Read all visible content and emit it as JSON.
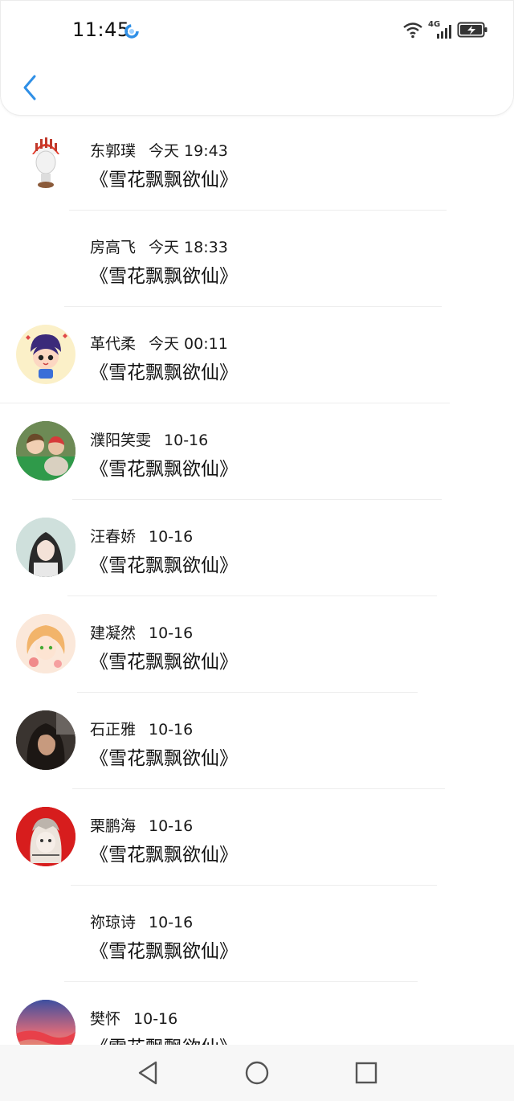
{
  "status_bar": {
    "time": "11:45",
    "network_label": "4G",
    "icons": [
      "activity-ring-icon",
      "wifi-icon",
      "signal-icon",
      "battery-charging-icon"
    ]
  },
  "header": {
    "back_icon": "chevron-left-icon"
  },
  "messages": [
    {
      "name": "东郭璞",
      "time": "今天 19:43",
      "title": "《雪花飘飘欲仙》",
      "avatar": "chief-statue"
    },
    {
      "name": "房高飞",
      "time": "今天 18:33",
      "title": "《雪花飘飘欲仙》",
      "avatar": "none"
    },
    {
      "name": "革代柔",
      "time": "今天 00:11",
      "title": "《雪花飘飘欲仙》",
      "avatar": "cartoon-boy"
    },
    {
      "name": "濮阳笑雯",
      "time": "10-16",
      "title": "《雪花飘飘欲仙》",
      "avatar": "couple-photo"
    },
    {
      "name": "汪春娇",
      "time": "10-16",
      "title": "《雪花飘飘欲仙》",
      "avatar": "girl-portrait"
    },
    {
      "name": "建凝然",
      "time": "10-16",
      "title": "《雪花飘飘欲仙》",
      "avatar": "anime-girl"
    },
    {
      "name": "石正雅",
      "time": "10-16",
      "title": "《雪花飘飘欲仙》",
      "avatar": "dark-portrait"
    },
    {
      "name": "栗鹏海",
      "time": "10-16",
      "title": "《雪花飘飘欲仙》",
      "avatar": "red-anime"
    },
    {
      "name": "祢琼诗",
      "time": "10-16",
      "title": "《雪花飘飘欲仙》",
      "avatar": "none"
    },
    {
      "name": "樊怀",
      "time": "10-16",
      "title": "《雪花飘飘欲仙》",
      "avatar": "sunset"
    }
  ],
  "navbar": {
    "icons": [
      "back-triangle-icon",
      "home-circle-icon",
      "recents-square-icon"
    ]
  },
  "colors": {
    "accent": "#2f8fe6",
    "divider": "#ededed",
    "navbar_bg": "#f7f7f7"
  }
}
